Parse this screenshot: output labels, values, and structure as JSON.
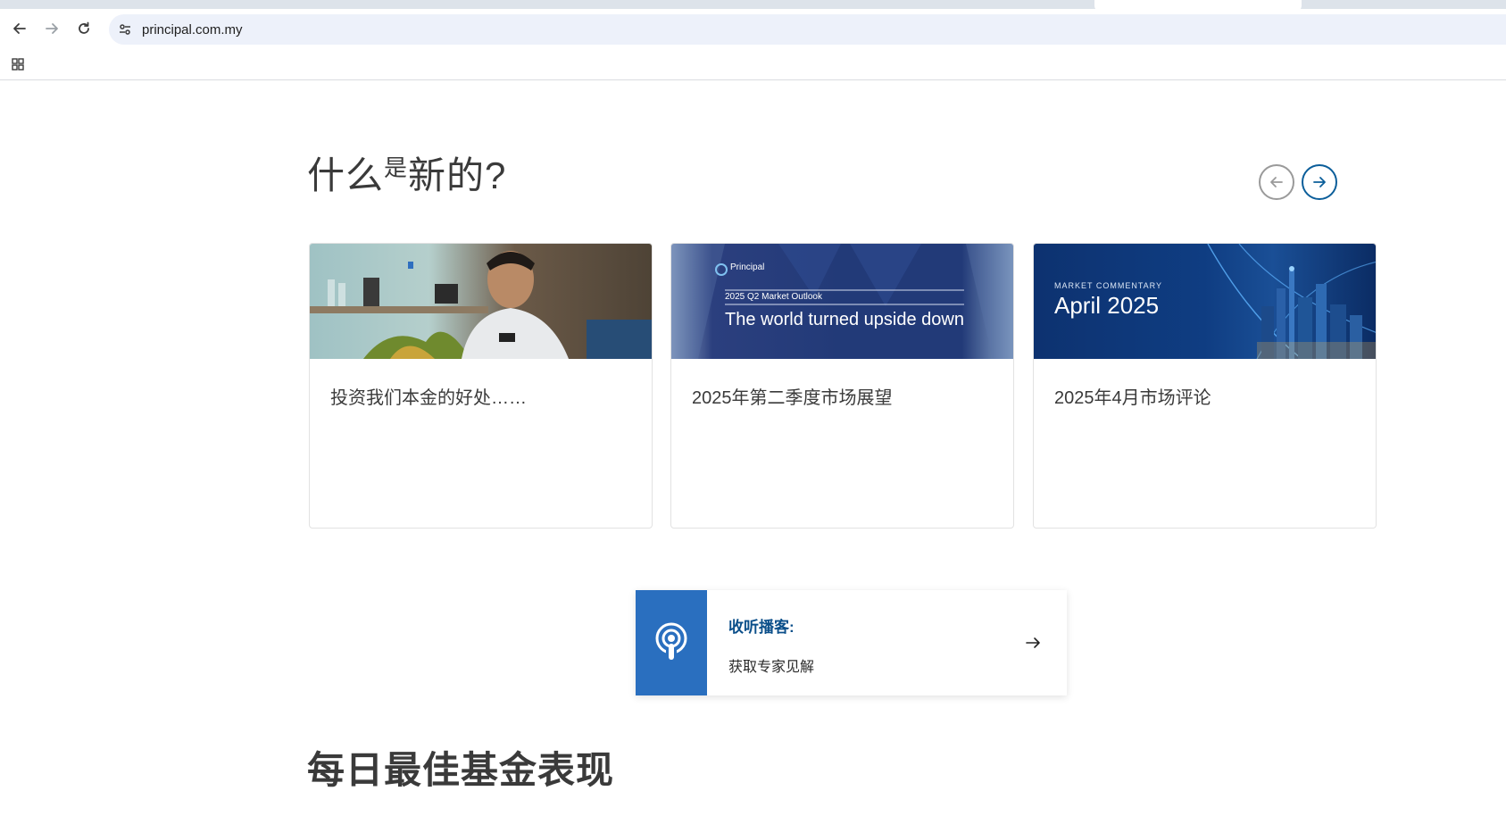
{
  "browser": {
    "url": "principal.com.my"
  },
  "whats_new": {
    "title_part1": "什么",
    "title_sup": "是",
    "title_part2": "新的?",
    "cards": [
      {
        "title": "投资我们本金的好处……",
        "thumb_text": []
      },
      {
        "title": "2025年第二季度市场展望",
        "thumb_brand": "Principal",
        "thumb_subtitle": "2025 Q2 Market Outlook",
        "thumb_heading": "The world turned upside down"
      },
      {
        "title": "2025年4月市场评论",
        "thumb_label": "MARKET COMMENTARY",
        "thumb_heading": "April 2025"
      }
    ]
  },
  "podcast": {
    "title": "收听播客:",
    "subtitle": "获取专家见解"
  },
  "daily_top_funds": {
    "title": "每日最佳基金表现"
  }
}
